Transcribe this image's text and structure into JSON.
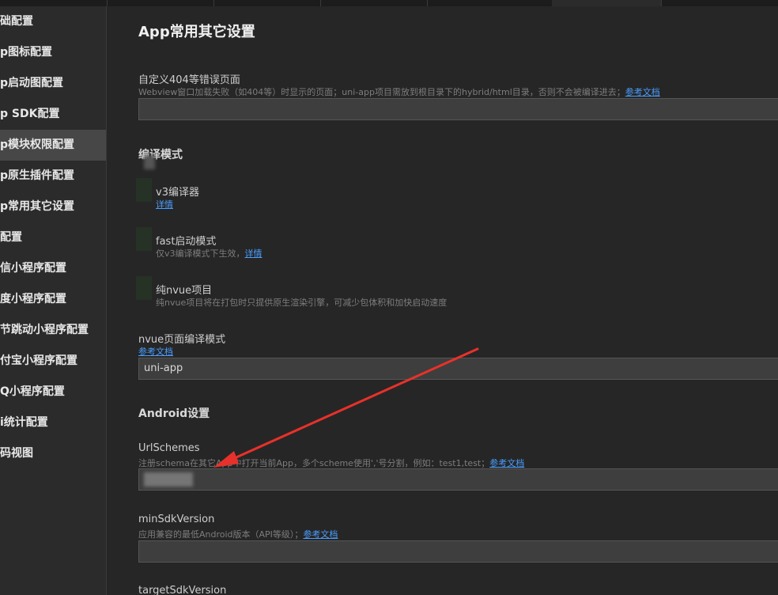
{
  "sidebar": {
    "items": [
      {
        "label": "础配置"
      },
      {
        "label": "p图标配置"
      },
      {
        "label": "p启动图配置"
      },
      {
        "label": "p SDK配置"
      },
      {
        "label": "p模块权限配置"
      },
      {
        "label": "p原生插件配置"
      },
      {
        "label": "p常用其它设置"
      },
      {
        "label": "配置"
      },
      {
        "label": "信小程序配置"
      },
      {
        "label": "度小程序配置"
      },
      {
        "label": "节跳动小程序配置"
      },
      {
        "label": "付宝小程序配置"
      },
      {
        "label": "Q小程序配置"
      },
      {
        "label": "i统计配置"
      },
      {
        "label": "码视图"
      }
    ],
    "active_index": 4
  },
  "main": {
    "title": "App常用其它设置",
    "error_page": {
      "label": "自定义404等错误页面",
      "desc": "Webview窗口加载失败（如404等）时显示的页面；uni-app项目需放到根目录下的hybrid/html目录，否则不会被编译进去；",
      "link": "参考文档",
      "value": ""
    },
    "compile_section": "编译模式",
    "v3": {
      "label": "v3编译器",
      "link": "详情"
    },
    "fast": {
      "label": "fast启动模式",
      "desc": "仅v3编译模式下生效，",
      "link": "详情"
    },
    "nvue": {
      "label": "纯nvue项目",
      "desc": "纯nvue项目将在打包时只提供原生渲染引擎，可减少包体积和加快启动速度"
    },
    "nvue_compile": {
      "label": "nvue页面编译模式",
      "link": "参考文档",
      "value": "uni-app"
    },
    "android_section": "Android设置",
    "url_schemes": {
      "label": "UrlSchemes",
      "desc": "注册schema在其它App中打开当前App，多个scheme使用','号分割，例如：test1,test；",
      "link": "参考文档"
    },
    "min_sdk": {
      "label": "minSdkVersion",
      "desc": "应用兼容的最低Android版本（API等级）；",
      "link": "参考文档",
      "value": ""
    },
    "target_sdk": {
      "label": "targetSdkVersion"
    }
  },
  "colors": {
    "background": "#262626",
    "sidebar": "#2b2b2b",
    "sidebar_active": "#474747",
    "link": "#4a9eff",
    "arrow": "#e8312a"
  }
}
